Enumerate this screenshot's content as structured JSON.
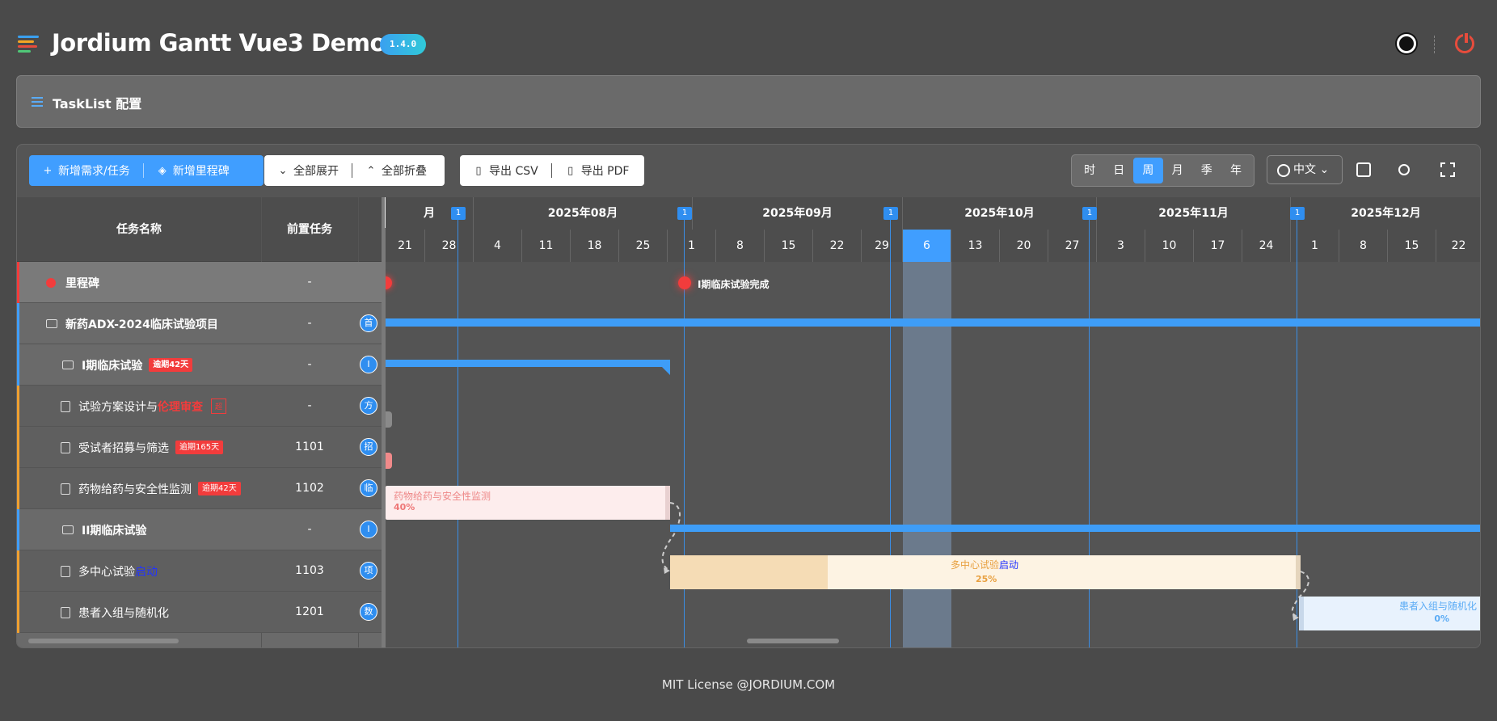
{
  "header": {
    "title": "Jordium Gantt Vue3 Demo",
    "version": "1.4.0"
  },
  "config_bar": {
    "label": "TaskList 配置"
  },
  "toolbar": {
    "add_task": "新增需求/任务",
    "add_milestone": "新增里程碑",
    "expand_all": "全部展开",
    "collapse_all": "全部折叠",
    "export_csv": "导出 CSV",
    "export_pdf": "导出 PDF",
    "time_scales": [
      "时",
      "日",
      "周",
      "月",
      "季",
      "年"
    ],
    "active_scale": "周",
    "language": "中文"
  },
  "task_list": {
    "columns": [
      "任务名称",
      "前置任务"
    ],
    "rows": [
      {
        "name": "里程碑",
        "pre": "-",
        "res": ""
      },
      {
        "name": "新药ADX-2024临床试验项目",
        "pre": "-",
        "res": "首"
      },
      {
        "name": "I期临床试验",
        "pre": "-",
        "res": "I",
        "tag": "逾期42天"
      },
      {
        "name": "试验方案设计与",
        "name_hl": "伦理审查",
        "pre": "-",
        "res": "方",
        "tag2": "超"
      },
      {
        "name": "受试者招募与筛选",
        "pre": "1101",
        "res": "招",
        "tag": "逾期165天"
      },
      {
        "name": "药物给药与安全性监测",
        "pre": "1102",
        "res": "临",
        "tag": "逾期42天"
      },
      {
        "name": "II期临床试验",
        "pre": "-",
        "res": "I"
      },
      {
        "name": "多中心试验",
        "name_hl": "启动",
        "pre": "1103",
        "res": "项"
      },
      {
        "name": "患者入组与随机化",
        "pre": "1201",
        "res": "数"
      }
    ]
  },
  "timeline": {
    "months": [
      "月",
      "2025年08月",
      "2025年09月",
      "2025年10月",
      "2025年11月",
      "2025年12月"
    ],
    "weeks": [
      "21",
      "28",
      "4",
      "11",
      "18",
      "25",
      "1",
      "8",
      "15",
      "22",
      "29",
      "6",
      "13",
      "20",
      "27",
      "3",
      "10",
      "17",
      "24",
      "1",
      "8",
      "15",
      "22"
    ],
    "current_week": "6",
    "milestone_flag": "1"
  },
  "gantt": {
    "milestone_label": "I期临床试验完成",
    "task_bar_1": {
      "name": "药物给药与安全性监测",
      "progress": "40%"
    },
    "task_bar_2": {
      "name": "多中心试验",
      "name_hl": "启动",
      "progress": "25%"
    },
    "task_bar_3": {
      "name": "患者入组与随机化",
      "progress": "0%"
    }
  },
  "footer": {
    "text": "MIT License @JORDIUM.COM"
  },
  "colors": {
    "accent": "#409eff",
    "danger": "#f23c3c",
    "bg": "#4a4a4a"
  }
}
